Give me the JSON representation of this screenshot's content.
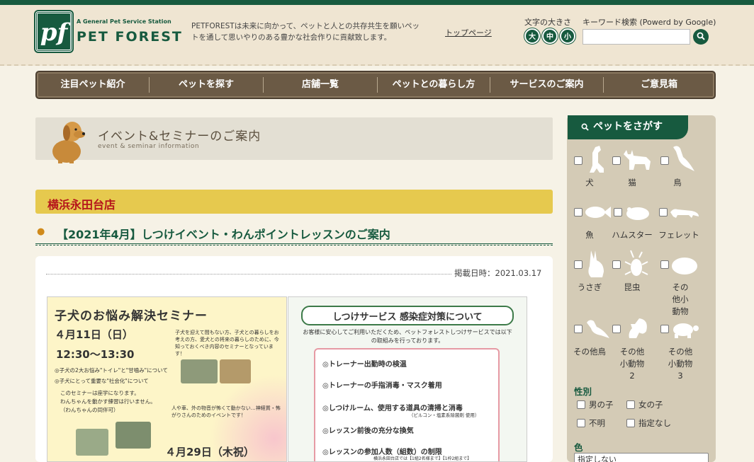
{
  "header": {
    "logo_mark": "pf",
    "logo_sub": "A General Pet Service Station",
    "logo_name": "PET FOREST",
    "tagline": "PETFORESTは未来に向かって、ペットと人との共存共生を願いペットを通して思いやりのある豊かな社会作りに貢献致します。",
    "top_link": "トップページ",
    "font_size_label": "文字の大きさ",
    "font_sizes": [
      "大",
      "中",
      "小"
    ],
    "keyword_label": "キーワード検索 (Powerd by Google)",
    "search_placeholder": "",
    "search_icon": "search-icon"
  },
  "nav": {
    "items": [
      "注目ペット紹介",
      "ペットを探す",
      "店舗一覧",
      "ペットとの暮らし方",
      "サービスのご案内",
      "ご意見箱"
    ]
  },
  "banner": {
    "title": "イベント&セミナーのご案内",
    "subtitle": "event & seminar information"
  },
  "article": {
    "store": "横浜永田台店",
    "title": "【2021年4月】しつけイベント・わんポイントレッスンのご案内",
    "date": "掲載日時：2021.03.17"
  },
  "flyer_left": {
    "heading": "子犬のお悩み解決セミナー",
    "date1": "４月11日（日）",
    "time1": "12:30〜13:30",
    "intro": "子犬を迎えて間もない方、子犬との暮らしをお考えの方、愛犬との将来の暮らしのために、今知っておくべき内容のセミナーとなっています！",
    "bullet1": "◎子犬の2大お悩み\"トイレ\"と\"甘噛み\"について",
    "bullet2": "◎子犬にとって重要な\"社会化\"について",
    "note1": "このセミナーは座学になります。",
    "note2": "わんちゃんを動かす練習は行いません。",
    "note3": "（わんちゃんの同伴可）",
    "walk": "人や車、外の物音が怖くて動かない…神経質・怖がりさんのためのイベントです！",
    "date2": "４月29日（木祝）"
  },
  "flyer_right": {
    "heading": "しつけサービス 感染症対策について",
    "intro": "お客様に安心してご利用いただくため、ペットフォレストしつけサービスでは以下の取組みを行っております。",
    "items": [
      "◎トレーナー出勤時の検温",
      "◎トレーナーの手指消毒・マスク着用",
      "◎しつけルーム、使用する道具の清掃と消毒",
      "◎レッスン前後の充分な換気",
      "◎レッスンの参加人数（組数）の制限"
    ],
    "item3_note": "（ビルコン・塩素系除菌剤 使用）",
    "item5_note": "横浜永田台店では【1組2名様まで】【1枠2組まで】"
  },
  "sidebar": {
    "head": "ペットをさがす",
    "pets": [
      {
        "label": "犬",
        "icon": "dog-icon"
      },
      {
        "label": "猫",
        "icon": "cat-icon"
      },
      {
        "label": "鳥",
        "icon": "bird-icon"
      },
      {
        "label": "魚",
        "icon": "fish-icon"
      },
      {
        "label": "ハムスター",
        "icon": "hamster-icon"
      },
      {
        "label": "フェレット",
        "icon": "ferret-icon"
      },
      {
        "label": "うさぎ",
        "icon": "rabbit-icon"
      },
      {
        "label": "昆虫",
        "icon": "beetle-icon"
      },
      {
        "label": "その他小動物",
        "icon": "small-animal-icon"
      },
      {
        "label": "その他鳥",
        "icon": "other-bird-icon"
      },
      {
        "label": "その他小動物2",
        "icon": "squirrel-icon"
      },
      {
        "label": "その他小動物3",
        "icon": "turtle-icon"
      }
    ],
    "gender_label": "性別",
    "genders": [
      "男の子",
      "女の子",
      "不明",
      "指定なし"
    ],
    "color_label": "色",
    "color_value": "指定しない"
  },
  "colors": {
    "brand_green": "#175a3f",
    "nav_brown": "#6b5a45",
    "store_bar": "#e6c94e",
    "store_text": "#b5141b"
  }
}
